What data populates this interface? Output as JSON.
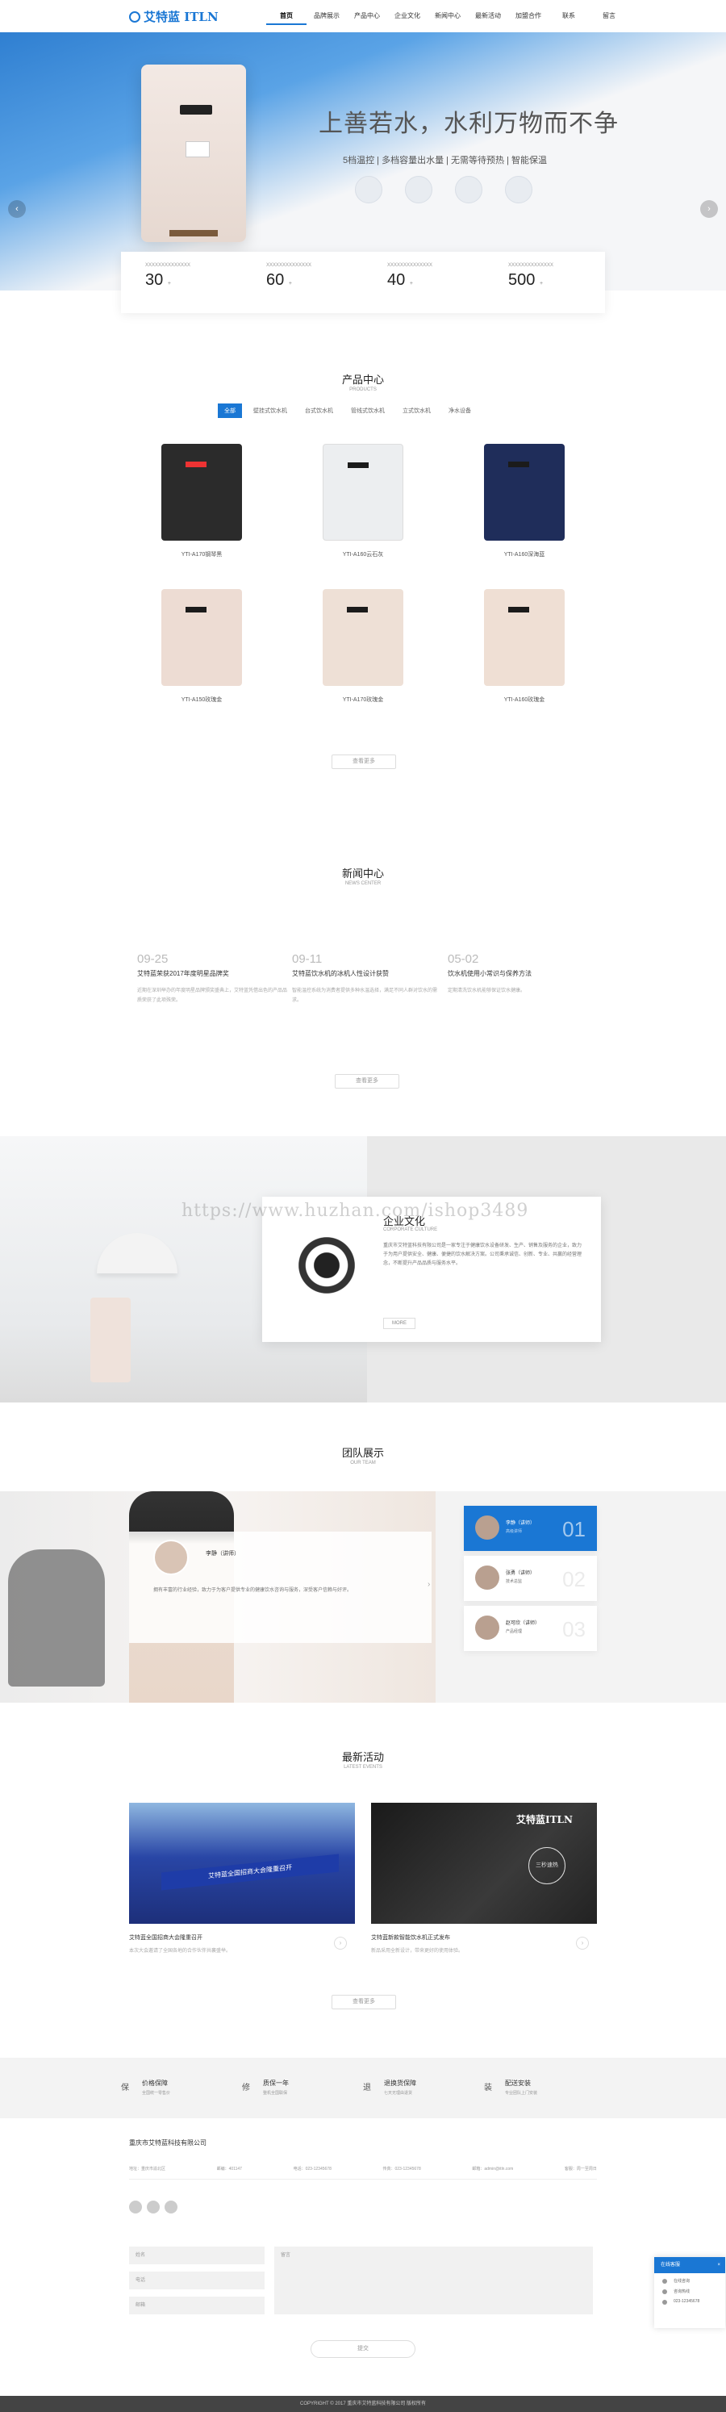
{
  "header": {
    "brand": "艾特蓝 ITLN",
    "nav": [
      "首页",
      "品牌展示",
      "产品中心",
      "企业文化",
      "新闻中心",
      "最新活动",
      "加盟合作",
      "联系",
      "留言"
    ]
  },
  "banner": {
    "slogan": "上善若水，水利万物而不争",
    "subslogan": "5档温控 | 多档容量出水量 | 无需等待预热 | 智能保温",
    "prev": "‹",
    "next": "›"
  },
  "stats": [
    {
      "label": "XXXXXXXXXXXXXX",
      "value": "30",
      "unit": "+"
    },
    {
      "label": "XXXXXXXXXXXXXX",
      "value": "60",
      "unit": "+"
    },
    {
      "label": "XXXXXXXXXXXXXX",
      "value": "40",
      "unit": "+"
    },
    {
      "label": "XXXXXXXXXXXXXX",
      "value": "500",
      "unit": "+"
    }
  ],
  "products": {
    "title": "产品中心",
    "subtitle": "PRODUCTS",
    "tabs": [
      "全部",
      "壁挂式饮水机",
      "台式饮水机",
      "管线式饮水机",
      "立式饮水机",
      "净水设备"
    ],
    "items": [
      {
        "name": "YTI-A170钢琴黑"
      },
      {
        "name": "YTI-A160云石灰"
      },
      {
        "name": "YTI-A160深海蓝"
      },
      {
        "name": "YTI-A150玫瑰金"
      },
      {
        "name": "YTI-A170玫瑰金"
      },
      {
        "name": "YTI-A160玫瑰金"
      }
    ],
    "more": "查看更多"
  },
  "news": {
    "title": "新闻中心",
    "subtitle": "NEWS CENTER",
    "items": [
      {
        "date": "09-25",
        "title": "艾特蓝荣获2017年度明星品牌奖",
        "desc": "近期在深圳举办的年度明星品牌颁奖盛典上，艾特蓝凭借出色的产品品质荣获了此项殊荣。"
      },
      {
        "date": "09-11",
        "title": "艾特蓝饮水机的冰机人性设计获赞",
        "desc": "智能温控系统为消费者提供多种水温选择，满足不同人群对饮水的需求。"
      },
      {
        "date": "05-02",
        "title": "饮水机使用小常识与保养方法",
        "desc": "定期清洗饮水机能够保证饮水健康。"
      }
    ],
    "more": "查看更多"
  },
  "culture": {
    "title": "企业文化",
    "subtitle": "CORPORATE CULTURE",
    "text": "重庆市艾特蓝科技有限公司是一家专注于健康饮水设备研发、生产、销售及服务的企业，致力于为用户提供安全、健康、便捷的饮水解决方案。公司秉承诚信、创新、专业、共赢的经营理念，不断提升产品品质与服务水平。",
    "more": "MORE",
    "watermark": "https://www.huzhan.com/ishop3489"
  },
  "team": {
    "title": "团队展示",
    "subtitle": "OUR TEAM",
    "featured": {
      "name": "李静（讲师）",
      "text": "拥有丰富的行业经验，致力于为客户提供专业的健康饮水咨询与服务，深受客户信赖与好评。"
    },
    "members": [
      {
        "name": "李静（讲师）",
        "role": "高级讲师",
        "no": "01"
      },
      {
        "name": "张勇（讲师）",
        "role": "技术总监",
        "no": "02"
      },
      {
        "name": "赵可欣（讲师）",
        "role": "产品经理",
        "no": "03"
      }
    ],
    "next": "›"
  },
  "activities": {
    "title": "最新活动",
    "subtitle": "LATEST EVENTS",
    "items": [
      {
        "title": "艾特蓝全国招商大会隆重召开",
        "desc": "本次大会邀请了全国各地的合作伙伴共襄盛举。",
        "banner_text": "艾特蓝全国招商大会隆重召开"
      },
      {
        "title": "艾特蓝新款智能饮水机正式发布",
        "desc": "新品采用全新设计，带来更好的使用体验。",
        "brand": "艾特蓝ITLN",
        "badge": "三秒速热"
      }
    ],
    "more": "查看更多"
  },
  "services": [
    {
      "title": "价格保障",
      "sub": "全国统一零售价",
      "icon": "保"
    },
    {
      "title": "质保一年",
      "sub": "整机全国联保",
      "icon": "修"
    },
    {
      "title": "退换货保障",
      "sub": "七天无理由退货",
      "icon": "退"
    },
    {
      "title": "配送安装",
      "sub": "专业团队上门安装",
      "icon": "装"
    }
  ],
  "footer": {
    "company": "重庆市艾特蓝科技有限公司",
    "info": [
      "地址：重庆市渝北区",
      "邮编：401147",
      "电话：023-12345678",
      "传真：023-12345678",
      "邮箱：admin@itln.com",
      "客服：周一至周日"
    ],
    "form": {
      "name": "姓名",
      "phone": "电话",
      "email": "邮箱",
      "message": "留言",
      "submit": "提交"
    },
    "copyright": "COPYRIGHT © 2017 重庆市艾特蓝科技有限公司 版权所有"
  },
  "float": {
    "title": "在线客服",
    "close": "×",
    "rows": [
      "在线咨询",
      "咨询热线",
      "023-12345678"
    ]
  }
}
